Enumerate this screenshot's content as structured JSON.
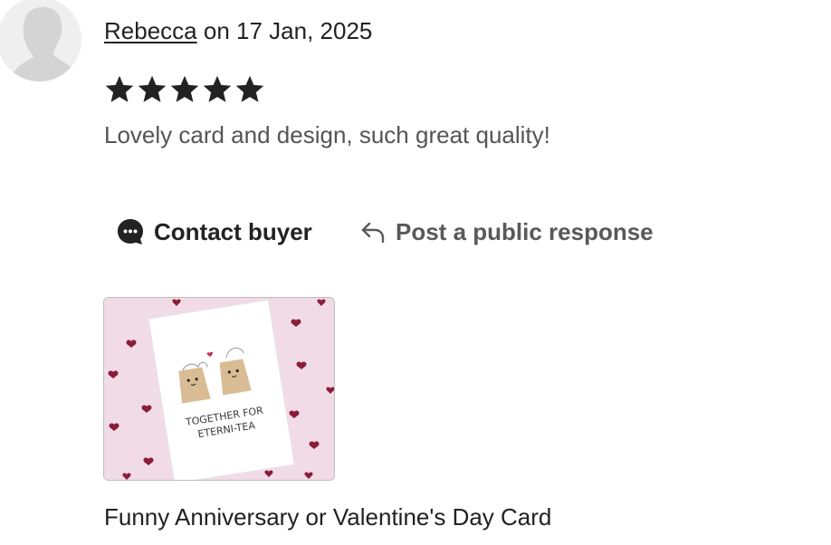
{
  "review": {
    "reviewer_name": "Rebecca",
    "date_prefix": "on",
    "date": "17 Jan, 2025",
    "rating": 5,
    "rating_max": 5,
    "text": "Lovely card and design, such great quality!"
  },
  "actions": {
    "contact_buyer_label": "Contact buyer",
    "contact_buyer_icon": "chat-bubble-icon",
    "post_response_label": "Post a public response",
    "post_response_icon": "reply-arrow-icon"
  },
  "product": {
    "title": "Funny Anniversary or Valentine's Day Card",
    "card_line_1": "TOGETHER FOR",
    "card_line_2": "ETERNI-TEA"
  },
  "colors": {
    "text_primary": "#222222",
    "text_secondary": "#555555",
    "thumb_background": "#f1dbe6",
    "heart": "#8a1d3a"
  }
}
